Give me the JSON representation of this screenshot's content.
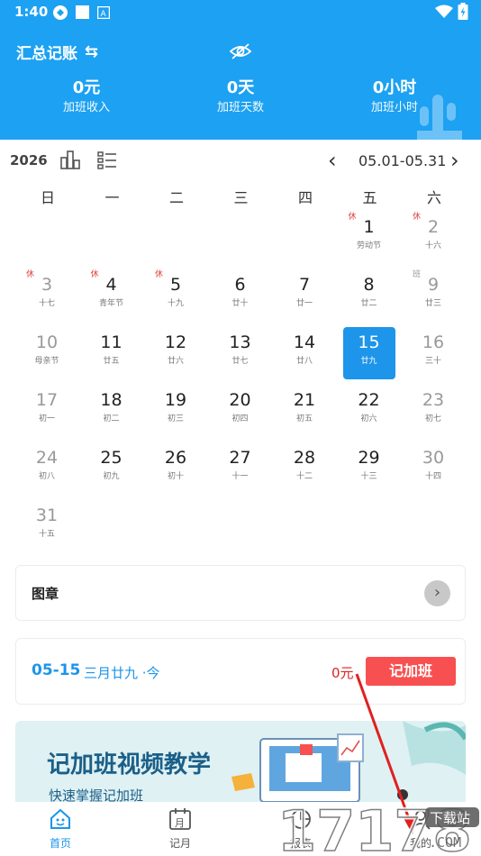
{
  "status_bar": {
    "time": "1:40"
  },
  "header": {
    "title": "汇总记账",
    "swap_icon": "⇆",
    "stats": [
      {
        "value": "0元",
        "label": "加班收入"
      },
      {
        "value": "0天",
        "label": "加班天数"
      },
      {
        "value": "0小时",
        "label": "加班小时"
      }
    ]
  },
  "month_bar": {
    "year": "2026",
    "range": "05.01-05.31",
    "prev_icon": "‹",
    "next_icon": "›"
  },
  "weekdays": [
    "日",
    "一",
    "二",
    "三",
    "四",
    "五",
    "六"
  ],
  "days": [
    {
      "d": "1",
      "s": "劳动节",
      "tag": "休"
    },
    {
      "d": "2",
      "s": "十六",
      "tag": "休"
    },
    {
      "d": "3",
      "s": "十七",
      "tag": "休"
    },
    {
      "d": "4",
      "s": "青年节",
      "tag": "休"
    },
    {
      "d": "5",
      "s": "十九",
      "tag": "休"
    },
    {
      "d": "6",
      "s": "廿十",
      "tag": ""
    },
    {
      "d": "7",
      "s": "廿一",
      "tag": ""
    },
    {
      "d": "8",
      "s": "廿二",
      "tag": ""
    },
    {
      "d": "9",
      "s": "廿三",
      "tag": "班"
    },
    {
      "d": "10",
      "s": "母亲节",
      "tag": ""
    },
    {
      "d": "11",
      "s": "廿五",
      "tag": ""
    },
    {
      "d": "12",
      "s": "廿六",
      "tag": ""
    },
    {
      "d": "13",
      "s": "廿七",
      "tag": ""
    },
    {
      "d": "14",
      "s": "廿八",
      "tag": ""
    },
    {
      "d": "15",
      "s": "廿九",
      "tag": ""
    },
    {
      "d": "16",
      "s": "三十",
      "tag": ""
    },
    {
      "d": "17",
      "s": "初一",
      "tag": ""
    },
    {
      "d": "18",
      "s": "初二",
      "tag": ""
    },
    {
      "d": "19",
      "s": "初三",
      "tag": ""
    },
    {
      "d": "20",
      "s": "初四",
      "tag": ""
    },
    {
      "d": "21",
      "s": "初五",
      "tag": ""
    },
    {
      "d": "22",
      "s": "初六",
      "tag": ""
    },
    {
      "d": "23",
      "s": "初七",
      "tag": ""
    },
    {
      "d": "24",
      "s": "初八",
      "tag": ""
    },
    {
      "d": "25",
      "s": "初九",
      "tag": ""
    },
    {
      "d": "26",
      "s": "初十",
      "tag": ""
    },
    {
      "d": "27",
      "s": "十一",
      "tag": ""
    },
    {
      "d": "28",
      "s": "十二",
      "tag": ""
    },
    {
      "d": "29",
      "s": "十三",
      "tag": ""
    },
    {
      "d": "30",
      "s": "十四",
      "tag": ""
    },
    {
      "d": "31",
      "s": "十五",
      "tag": ""
    }
  ],
  "seal": {
    "title": "图章",
    "go_icon": "›"
  },
  "record": {
    "date": "05-15",
    "lunar": "三月廿九 ·今",
    "amount": "0元",
    "button": "记加班"
  },
  "banner": {
    "title": "记加班视频教学",
    "subtitle": "快速掌握记加班"
  },
  "tabs": [
    {
      "label": "首页",
      "icon": "home-icon"
    },
    {
      "label": "记月",
      "icon": "calendar-icon"
    },
    {
      "label": "报表",
      "icon": "chart-icon"
    },
    {
      "label": "我的",
      "icon": "user-icon"
    }
  ],
  "watermark": {
    "text": "17178",
    "badge": "下载站",
    "domain": ".COM"
  },
  "colors": {
    "primary": "#1da1f2",
    "selected": "#1d95ea",
    "accent": "#f85050",
    "holiday": "#e04040"
  }
}
